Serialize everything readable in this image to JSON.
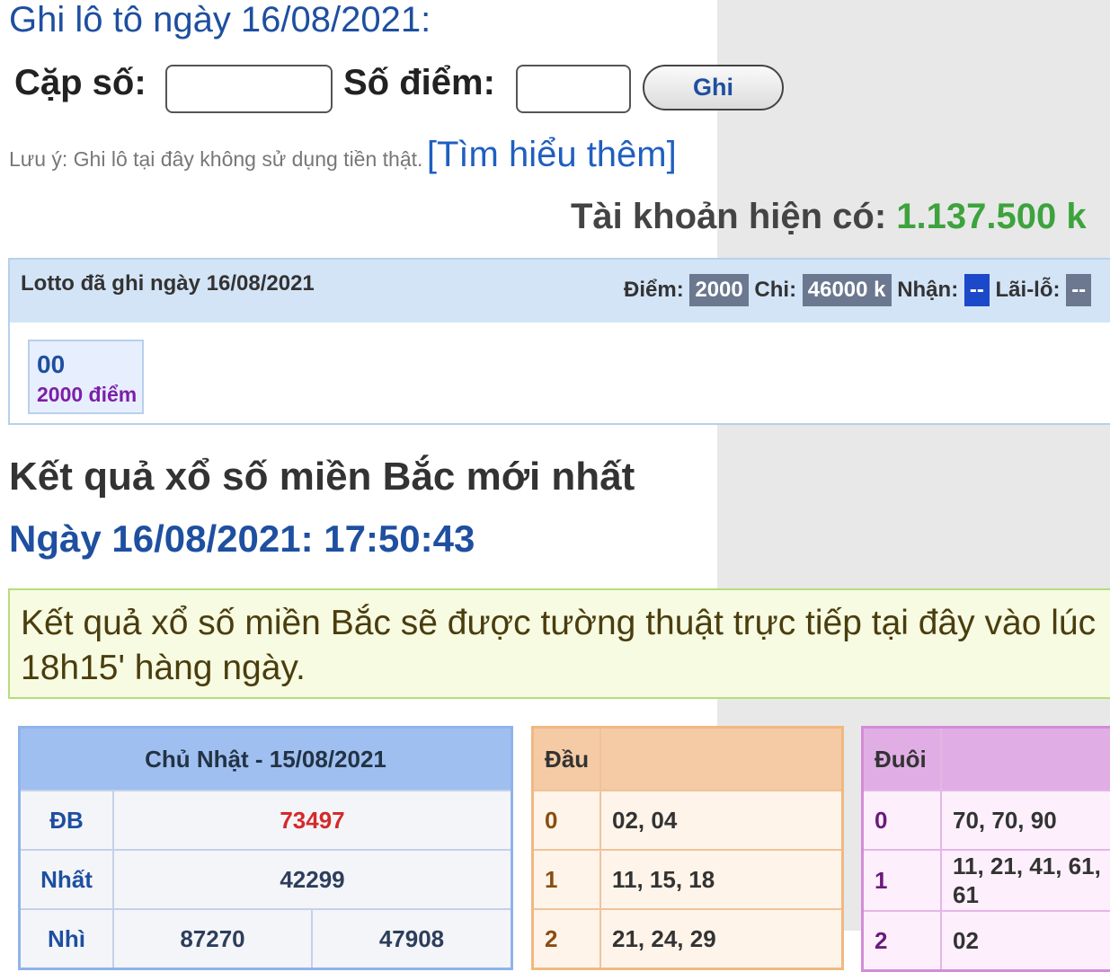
{
  "form": {
    "title": "Ghi lô tô ngày 16/08/2021:",
    "pair_label": "Cặp số:",
    "points_label": "Số điểm:",
    "pair_value": "",
    "points_value": "",
    "submit_label": "Ghi",
    "note_text": "Lưu ý: Ghi lô tại đây không sử dụng tiền thật.",
    "note_link": "[Tìm hiểu thêm]"
  },
  "account": {
    "label": "Tài khoản hiện có:",
    "amount": "1.137.500 k"
  },
  "lotto": {
    "title": "Lotto đã ghi ngày 16/08/2021",
    "diem_label": "Điểm:",
    "diem_value": "2000",
    "chi_label": "Chi:",
    "chi_value": "46000 k",
    "nhan_label": "Nhận:",
    "nhan_value": "--",
    "lailo_label": "Lãi-lỗ:",
    "lailo_value": "--",
    "entries": [
      {
        "number": "00",
        "points": "2000 điểm"
      }
    ]
  },
  "results": {
    "title": "Kết quả xổ số miền Bắc mới nhất",
    "date_line": "Ngày 16/08/2021: 17:50:43",
    "notice": "Kết quả xổ số miền Bắc sẽ được tường thuật trực tiếp tại đây vào lúc 18h15' hàng ngày.",
    "table": {
      "header": "Chủ Nhật - 15/08/2021",
      "rows": [
        {
          "prize": "ĐB",
          "values": [
            "73497"
          ]
        },
        {
          "prize": "Nhất",
          "values": [
            "42299"
          ]
        },
        {
          "prize": "Nhì",
          "values": [
            "87270",
            "47908"
          ]
        }
      ]
    },
    "dau": {
      "header": "Đầu",
      "rows": [
        {
          "key": "0",
          "values": "02, 04"
        },
        {
          "key": "1",
          "values": "11, 15, 18"
        },
        {
          "key": "2",
          "values": "21, 24, 29"
        }
      ]
    },
    "duoi": {
      "header": "Đuôi",
      "rows": [
        {
          "key": "0",
          "values": "70, 70, 90"
        },
        {
          "key": "1",
          "values": "11, 21, 41, 61, 61"
        },
        {
          "key": "2",
          "values": "02"
        }
      ]
    }
  },
  "colors": {
    "accent_blue": "#1e4fa0",
    "amount_green": "#3da33d",
    "db_red": "#d42a2a"
  }
}
